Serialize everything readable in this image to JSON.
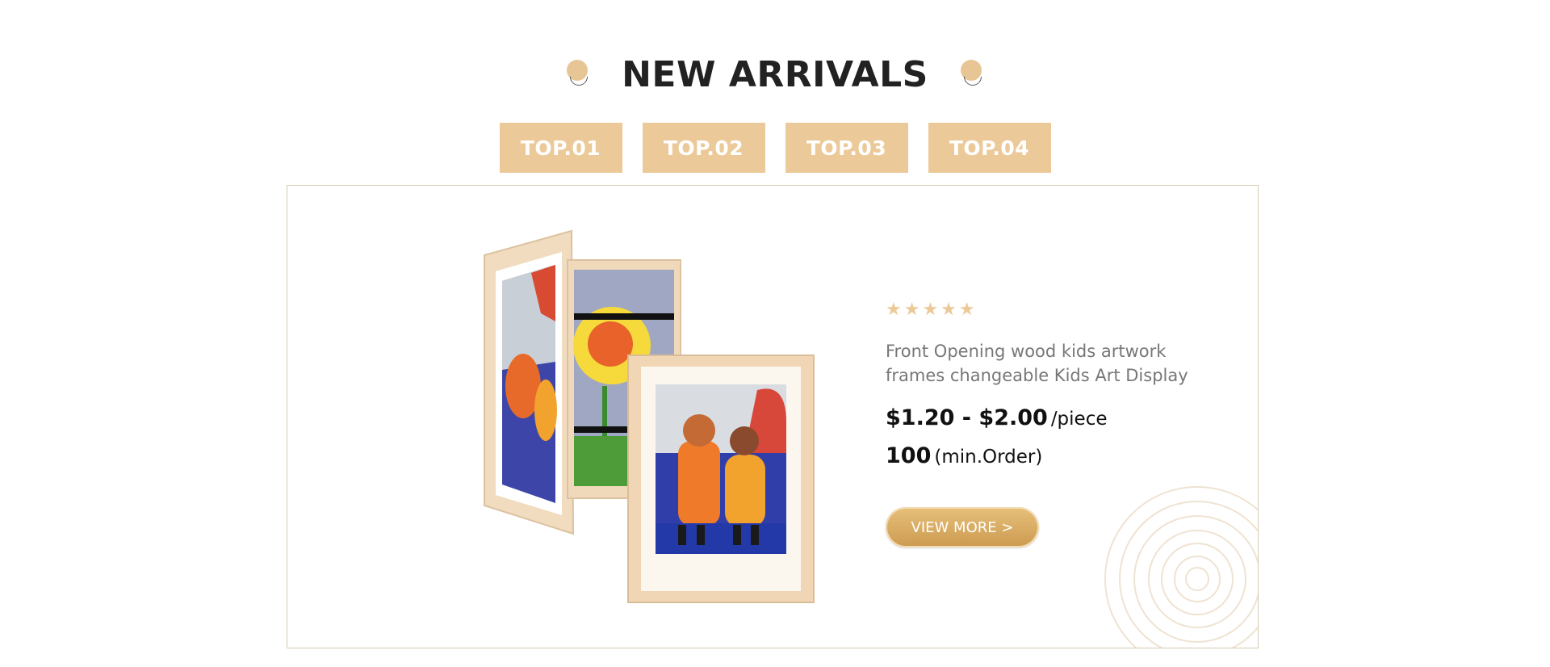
{
  "section": {
    "title": "NEW ARRIVALS"
  },
  "tabs": [
    {
      "label": "TOP.01"
    },
    {
      "label": "TOP.02"
    },
    {
      "label": "TOP.03"
    },
    {
      "label": "TOP.04"
    }
  ],
  "product": {
    "rating": 5,
    "stars": "★★★★★",
    "title_line1": "Front Opening wood kids artwork",
    "title_line2": "frames changeable Kids Art Display",
    "price": "$1.20 - $2.00",
    "price_unit": "/piece",
    "moq": "100",
    "moq_unit": "(min.Order)",
    "button_label": "VIEW MORE >"
  },
  "colors": {
    "accent": "#ecc998",
    "button": "#d6a861",
    "border": "#d8ccb4"
  },
  "icons": [
    "star-icon",
    "decorative-dot-icon",
    "wood-rings-decoration"
  ]
}
